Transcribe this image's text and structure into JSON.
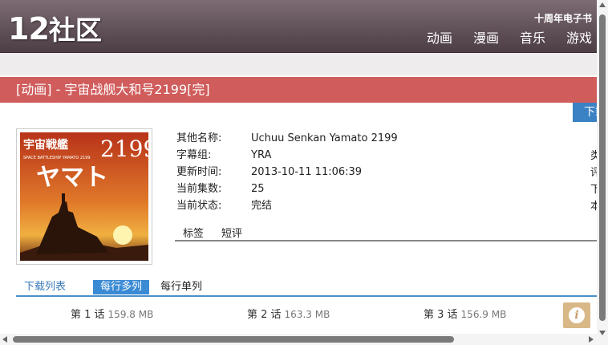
{
  "header": {
    "logo_num": "12",
    "logo_text": "社区",
    "ebook": "十周年电子书",
    "nav": [
      "动画",
      "漫画",
      "音乐",
      "游戏"
    ]
  },
  "title": "[动画] - 宇宙战舰大和号2199[完]",
  "download_button": "下载",
  "cover": {
    "title_jp": "宇宙戦艦",
    "title_num": "2199",
    "title_kana": "ヤマト",
    "subtitle": "SPACE BATTLESHIP YAMATO 2199"
  },
  "info": [
    {
      "key": "其他名称:",
      "value": "Uchuu Senkan Yamato 2199"
    },
    {
      "key": "字幕组:",
      "value": "YRA"
    },
    {
      "key": "更新时间:",
      "value": "2013-10-11 11:06:39"
    },
    {
      "key": "当前集数:",
      "value": "25"
    },
    {
      "key": "当前状态:",
      "value": "完结"
    }
  ],
  "info_right_clip": [
    "类",
    "评",
    "下",
    "本"
  ],
  "tabs": [
    "标签",
    "短评"
  ],
  "download_list": {
    "title": "下载列表",
    "mode_multi": "每行多列",
    "mode_single": "每行单列"
  },
  "episodes": [
    {
      "label": "第 1 话",
      "size": "159.8 MB"
    },
    {
      "label": "第 2 话",
      "size": "163.3 MB"
    },
    {
      "label": "第 3 话",
      "size": "156.9 MB"
    }
  ],
  "colors": {
    "header": "#5a4a52",
    "title_bar": "#d05c5c",
    "accent_blue": "#3a82c4"
  }
}
